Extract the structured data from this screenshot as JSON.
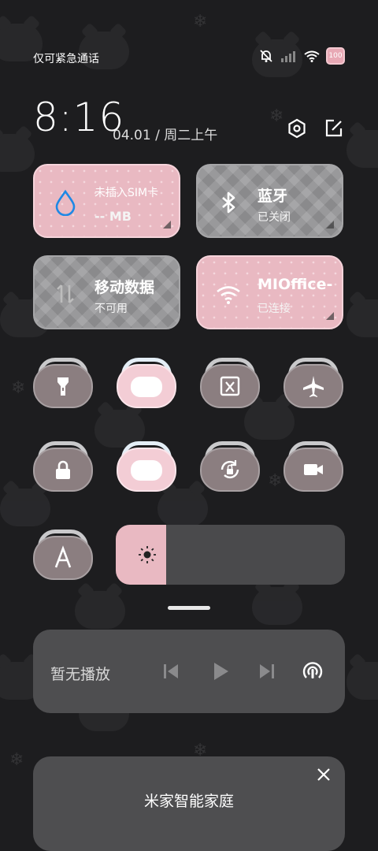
{
  "status_bar": {
    "carrier": "仅可紧急通话",
    "battery": "100"
  },
  "header": {
    "time": "8:16",
    "date": "04.01 / 周二上午"
  },
  "tiles": {
    "data_usage": {
      "title": "未插入SIM卡",
      "value": "-- MB"
    },
    "bluetooth": {
      "title": "蓝牙",
      "status": "已关闭"
    },
    "mobile_data": {
      "title": "移动数据",
      "status": "不可用"
    },
    "wifi": {
      "title": "MIOffice-",
      "status": "已连接"
    }
  },
  "toggles": [
    {
      "icon": "flashlight-icon",
      "active": false
    },
    {
      "icon": "unknown-active-toggle-icon",
      "active": true
    },
    {
      "icon": "screenshot-crop-icon",
      "active": false
    },
    {
      "icon": "airplane-icon",
      "active": false
    },
    {
      "icon": "lock-icon",
      "active": false
    },
    {
      "icon": "unknown-active-toggle-icon",
      "active": true
    },
    {
      "icon": "rotation-lock-icon",
      "active": false
    },
    {
      "icon": "screen-record-icon",
      "active": false
    },
    {
      "icon": "font-size-icon",
      "active": false
    }
  ],
  "brightness": {
    "level_fraction": 0.22
  },
  "media": {
    "label": "暂无播放"
  },
  "card": {
    "title": "米家智能家庭"
  },
  "colors": {
    "pink": "#e9b9c2",
    "panel": "#4e4e50",
    "background": "#1d1d1f"
  }
}
